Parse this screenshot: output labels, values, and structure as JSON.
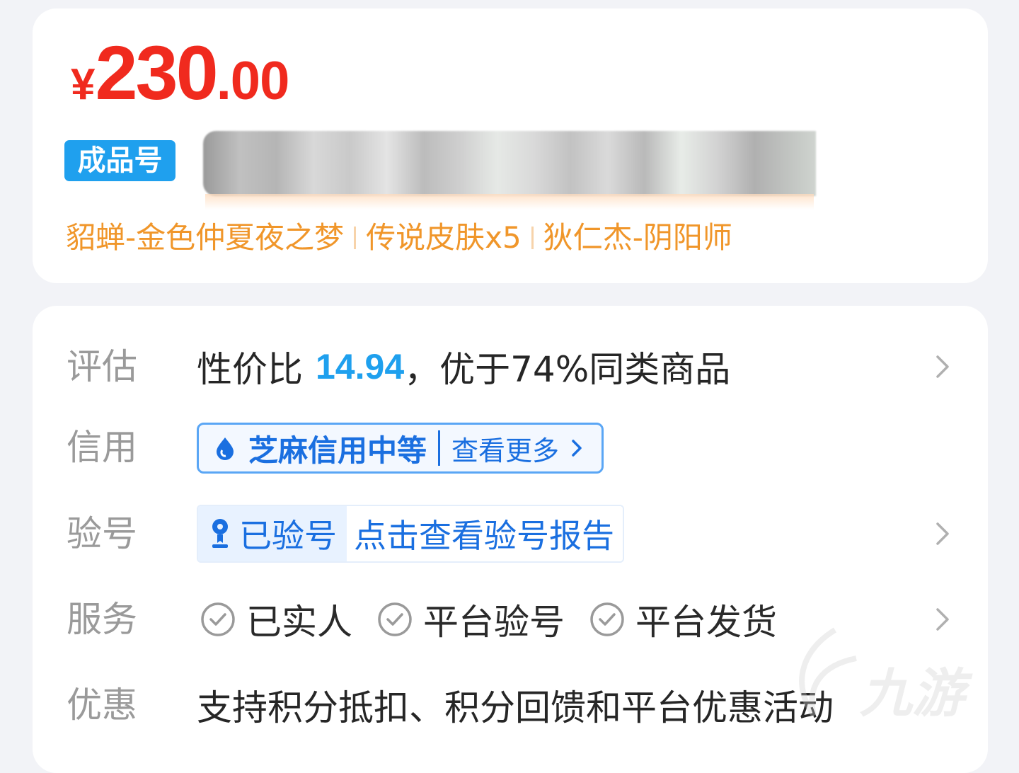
{
  "price": {
    "currency": "¥",
    "integer": "230",
    "decimal": ".00"
  },
  "badge": "成品号",
  "tags": [
    "貂蝉-金色仲夏夜之梦",
    "传说皮肤x5",
    "狄仁杰-阴阳师"
  ],
  "rows": {
    "evaluate": {
      "label": "评估",
      "prefix": "性价比 ",
      "value": "14.94",
      "suffix": "，优于74%同类商品"
    },
    "credit": {
      "label": "信用",
      "title": "芝麻信用中等",
      "more": "查看更多"
    },
    "verify": {
      "label": "验号",
      "badge": "已验号",
      "link": "点击查看验号报告"
    },
    "service": {
      "label": "服务",
      "items": [
        "已实人",
        "平台验号",
        "平台发货"
      ]
    },
    "discount": {
      "label": "优惠",
      "text": "支持积分抵扣、积分回馈和平台优惠活动"
    }
  },
  "watermark": "九游",
  "colors": {
    "price": "#f02a1e",
    "badge": "#1fa0ee",
    "tags": "#f0962a",
    "link": "#1a6fe0"
  }
}
